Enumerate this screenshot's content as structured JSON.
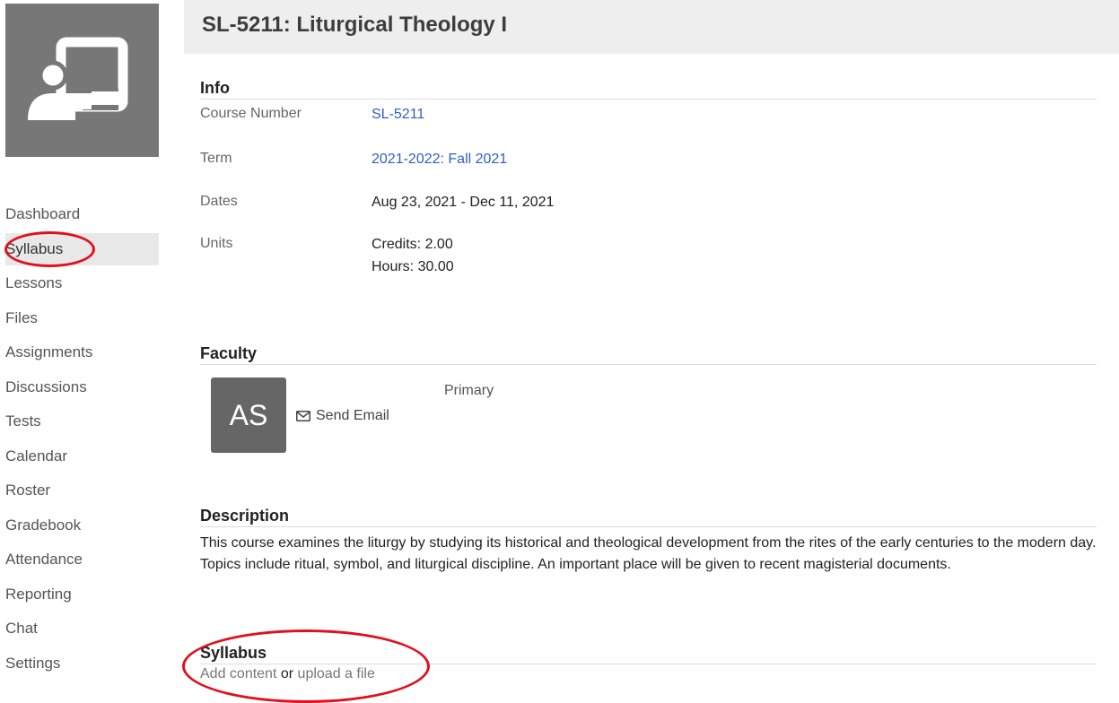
{
  "course_image": {
    "icon": "classroom-presentation-icon",
    "background": "#777777"
  },
  "sidebar": {
    "items": [
      {
        "label": "Dashboard"
      },
      {
        "label": "Syllabus",
        "active": true
      },
      {
        "label": "Lessons"
      },
      {
        "label": "Files"
      },
      {
        "label": "Assignments"
      },
      {
        "label": "Discussions"
      },
      {
        "label": "Tests"
      },
      {
        "label": "Calendar"
      },
      {
        "label": "Roster"
      },
      {
        "label": "Gradebook"
      },
      {
        "label": "Attendance"
      },
      {
        "label": "Reporting"
      },
      {
        "label": "Chat"
      },
      {
        "label": "Settings"
      }
    ]
  },
  "header": {
    "title": "SL-5211: Liturgical Theology I"
  },
  "info": {
    "heading": "Info",
    "course_number_label": "Course Number",
    "course_number_value": "SL-5211",
    "term_label": "Term",
    "term_value": "2021-2022: Fall 2021",
    "dates_label": "Dates",
    "dates_value": "Aug 23, 2021 - Dec 11, 2021",
    "units_label": "Units",
    "credits_value": "Credits: 2.00",
    "hours_value": "Hours: 30.00"
  },
  "faculty": {
    "heading": "Faculty",
    "avatar_initials": "AS",
    "send_email_label": "Send Email",
    "role": "Primary"
  },
  "description": {
    "heading": "Description",
    "text": "This course examines the liturgy by studying its historical and theological development from the rites of the early centuries to the modern day. Topics include ritual, symbol, and liturgical discipline. An important place will be given to recent magisterial documents."
  },
  "syllabus": {
    "heading": "Syllabus",
    "add_content_label": "Add content",
    "or_label": "or",
    "upload_label": "upload a file"
  },
  "colors": {
    "link": "#2f5fc4",
    "annotation": "#e0111c",
    "title_bar": "#eeeeee"
  }
}
